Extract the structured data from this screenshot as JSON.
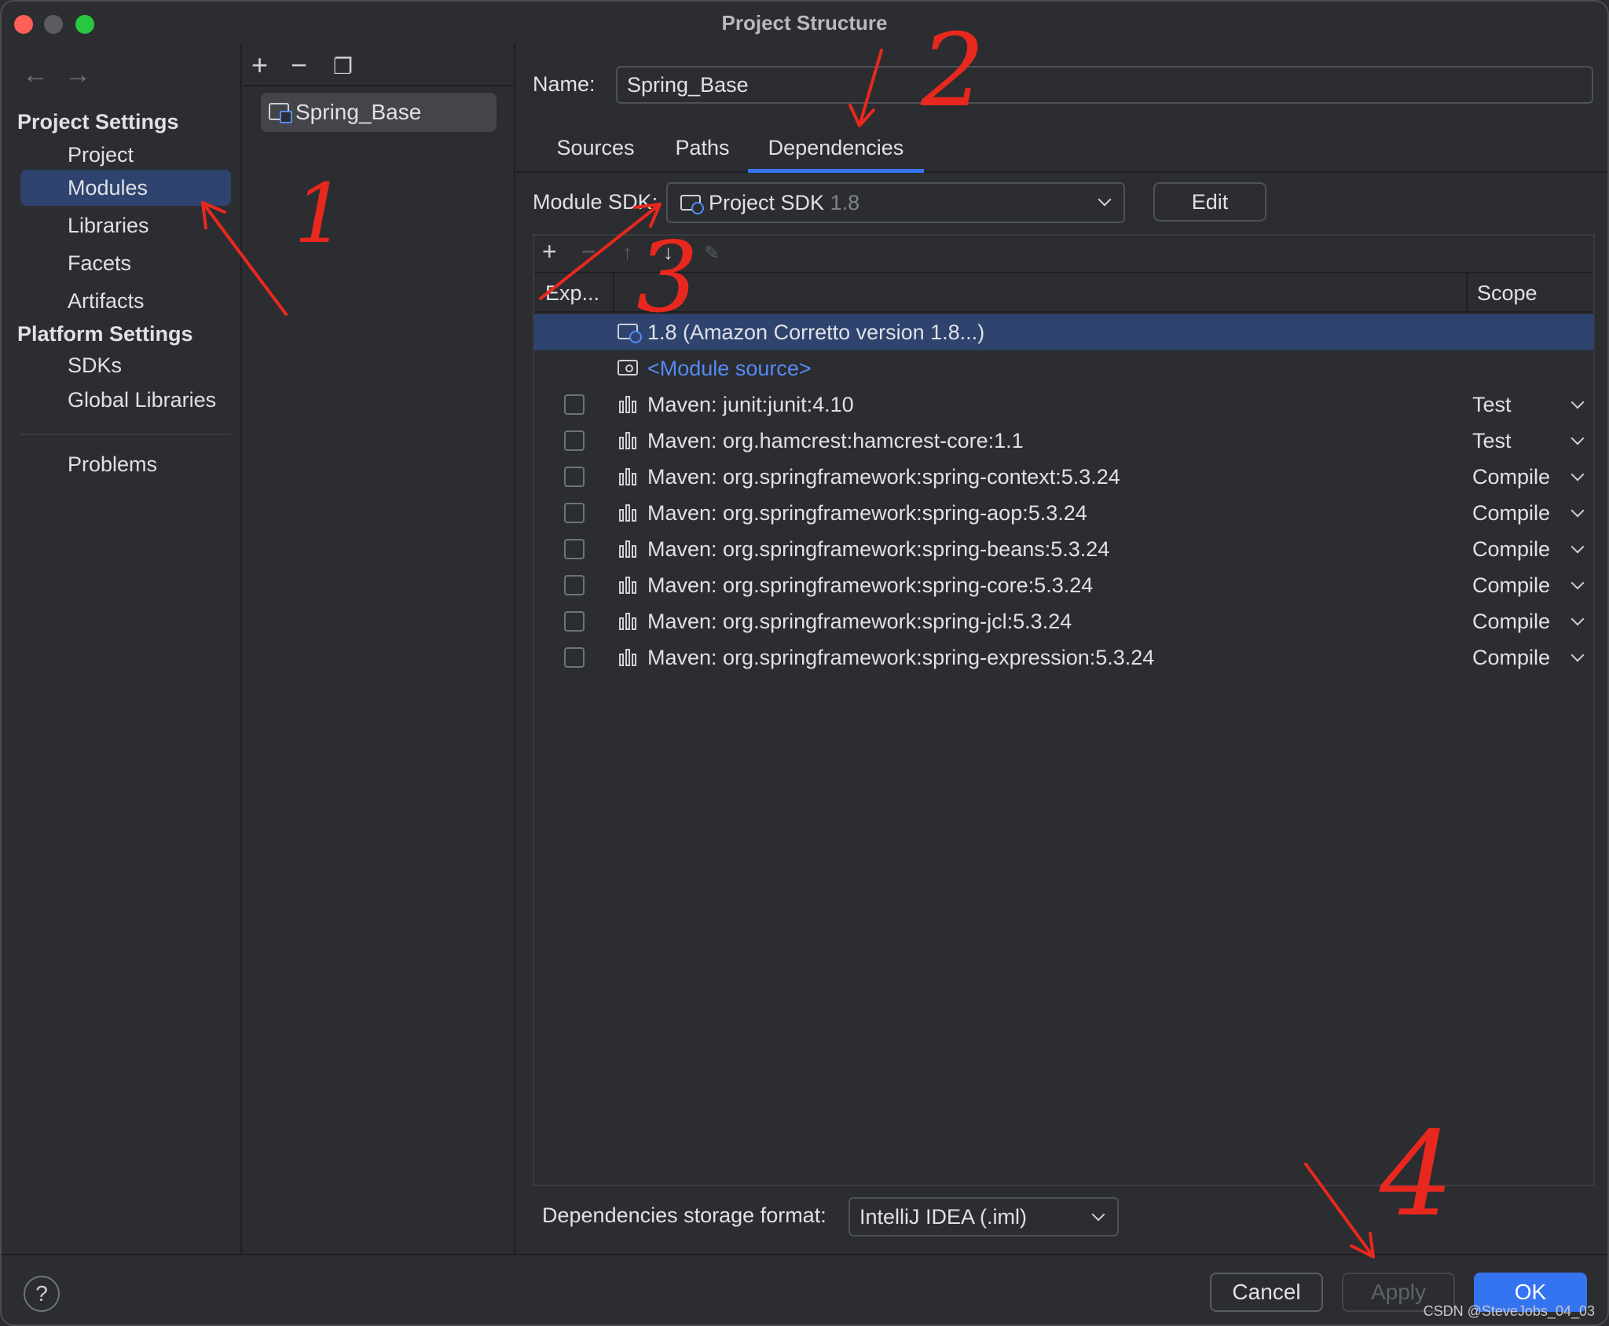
{
  "window": {
    "title": "Project Structure"
  },
  "nav": {
    "project_settings": "Project Settings",
    "items_project": [
      "Project",
      "Modules",
      "Libraries",
      "Facets",
      "Artifacts"
    ],
    "platform_settings": "Platform Settings",
    "items_platform": [
      "SDKs",
      "Global Libraries"
    ],
    "problems": "Problems"
  },
  "modules": {
    "items": [
      "Spring_Base"
    ]
  },
  "module": {
    "name_label": "Name:",
    "name_value": "Spring_Base",
    "tabs": [
      "Sources",
      "Paths",
      "Dependencies"
    ],
    "sdk_label": "Module SDK:",
    "sdk_value": "Project SDK",
    "sdk_version": "1.8",
    "edit_label": "Edit"
  },
  "deps": {
    "col_export": "Exp...",
    "col_scope": "Scope",
    "rows": [
      {
        "name": "1.8 (Amazon Corretto version 1.8...)",
        "scope": ""
      },
      {
        "name": "<Module source>",
        "scope": ""
      },
      {
        "name": "Maven: junit:junit:4.10",
        "scope": "Test"
      },
      {
        "name": "Maven: org.hamcrest:hamcrest-core:1.1",
        "scope": "Test"
      },
      {
        "name": "Maven: org.springframework:spring-context:5.3.24",
        "scope": "Compile"
      },
      {
        "name": "Maven: org.springframework:spring-aop:5.3.24",
        "scope": "Compile"
      },
      {
        "name": "Maven: org.springframework:spring-beans:5.3.24",
        "scope": "Compile"
      },
      {
        "name": "Maven: org.springframework:spring-core:5.3.24",
        "scope": "Compile"
      },
      {
        "name": "Maven: org.springframework:spring-jcl:5.3.24",
        "scope": "Compile"
      },
      {
        "name": "Maven: org.springframework:spring-expression:5.3.24",
        "scope": "Compile"
      }
    ],
    "storage_label": "Dependencies storage format:",
    "storage_value": "IntelliJ IDEA (.iml)"
  },
  "footer": {
    "help": "?",
    "cancel": "Cancel",
    "apply": "Apply",
    "ok": "OK"
  },
  "watermark": "CSDN @SteveJobs_04_03",
  "annotations": {
    "mark_1": "1",
    "mark_2": "2",
    "mark_3": "3",
    "mark_4": "4",
    "color": "#e8281e"
  },
  "colors": {
    "accent": "#3574f0",
    "selection": "#2e436e",
    "link": "#548af7"
  }
}
